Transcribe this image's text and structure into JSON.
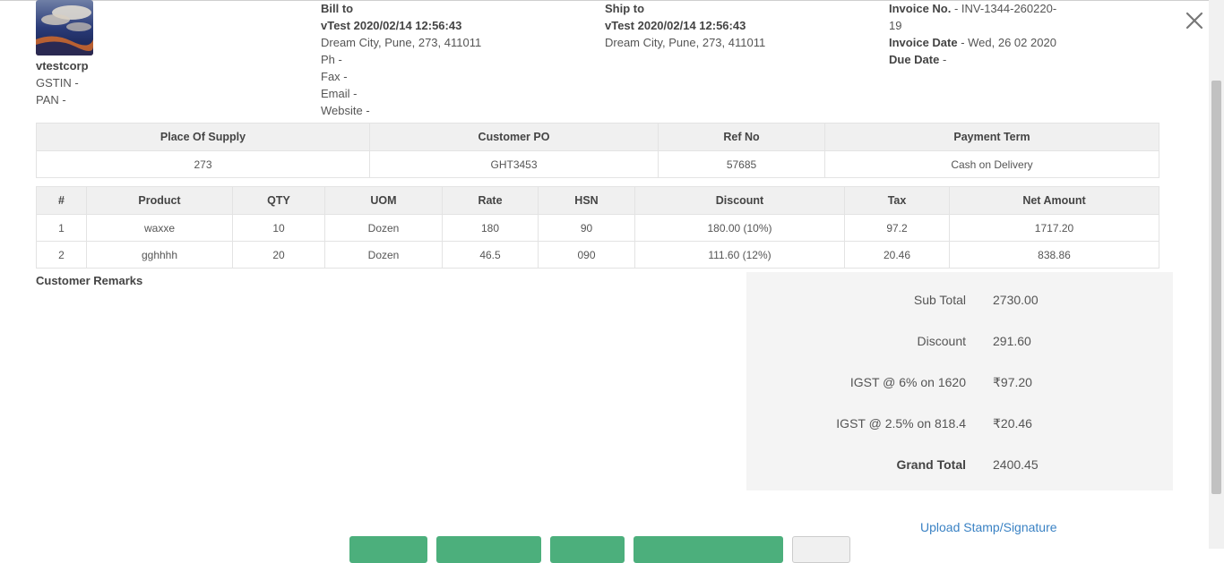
{
  "company": {
    "name": "vtestcorp",
    "gstin": "GSTIN -",
    "pan": "PAN -"
  },
  "bill_to": {
    "heading": "Bill to",
    "name": "vTest 2020/02/14 12:56:43",
    "address": "Dream City, Pune, 273, 411011",
    "ph": "Ph -",
    "fax": "Fax -",
    "email": "Email -",
    "website": "Website -"
  },
  "ship_to": {
    "heading": "Ship to",
    "name": "vTest 2020/02/14 12:56:43",
    "address": "Dream City, Pune, 273, 411011"
  },
  "invoice": {
    "no_label": "Invoice No.",
    "no_value": " - INV-1344-260220-",
    "no_value_2": "19",
    "date_label": "Invoice Date",
    "date_value": " - Wed, 26 02 2020",
    "due_label": "Due Date",
    "due_value": " -"
  },
  "supply_table": {
    "headers": [
      "Place Of Supply",
      "Customer PO",
      "Ref No",
      "Payment Term"
    ],
    "row": [
      "273",
      "GHT3453",
      "57685",
      "Cash on Delivery"
    ]
  },
  "items_table": {
    "headers": [
      "#",
      "Product",
      "QTY",
      "UOM",
      "Rate",
      "HSN",
      "Discount",
      "Tax",
      "Net Amount"
    ],
    "rows": [
      [
        "1",
        "waxxe",
        "10",
        "Dozen",
        "180",
        "90",
        "180.00 (10%)",
        "97.2",
        "1717.20"
      ],
      [
        "2",
        "gghhhh",
        "20",
        "Dozen",
        "46.5",
        "090",
        "111.60 (12%)",
        "20.46",
        "838.86"
      ]
    ]
  },
  "remarks_label": "Customer Remarks",
  "totals": [
    {
      "label": "Sub Total",
      "value": "2730.00"
    },
    {
      "label": "Discount",
      "value": "291.60"
    },
    {
      "label": "IGST @ 6% on 1620",
      "value": "₹97.20"
    },
    {
      "label": "IGST @ 2.5% on 818.4",
      "value": "₹20.46"
    },
    {
      "label": "Grand Total",
      "value": "2400.45"
    }
  ],
  "upload_link": "Upload Stamp/Signature",
  "icons": {
    "close": "close-icon",
    "logo": "company-logo"
  }
}
